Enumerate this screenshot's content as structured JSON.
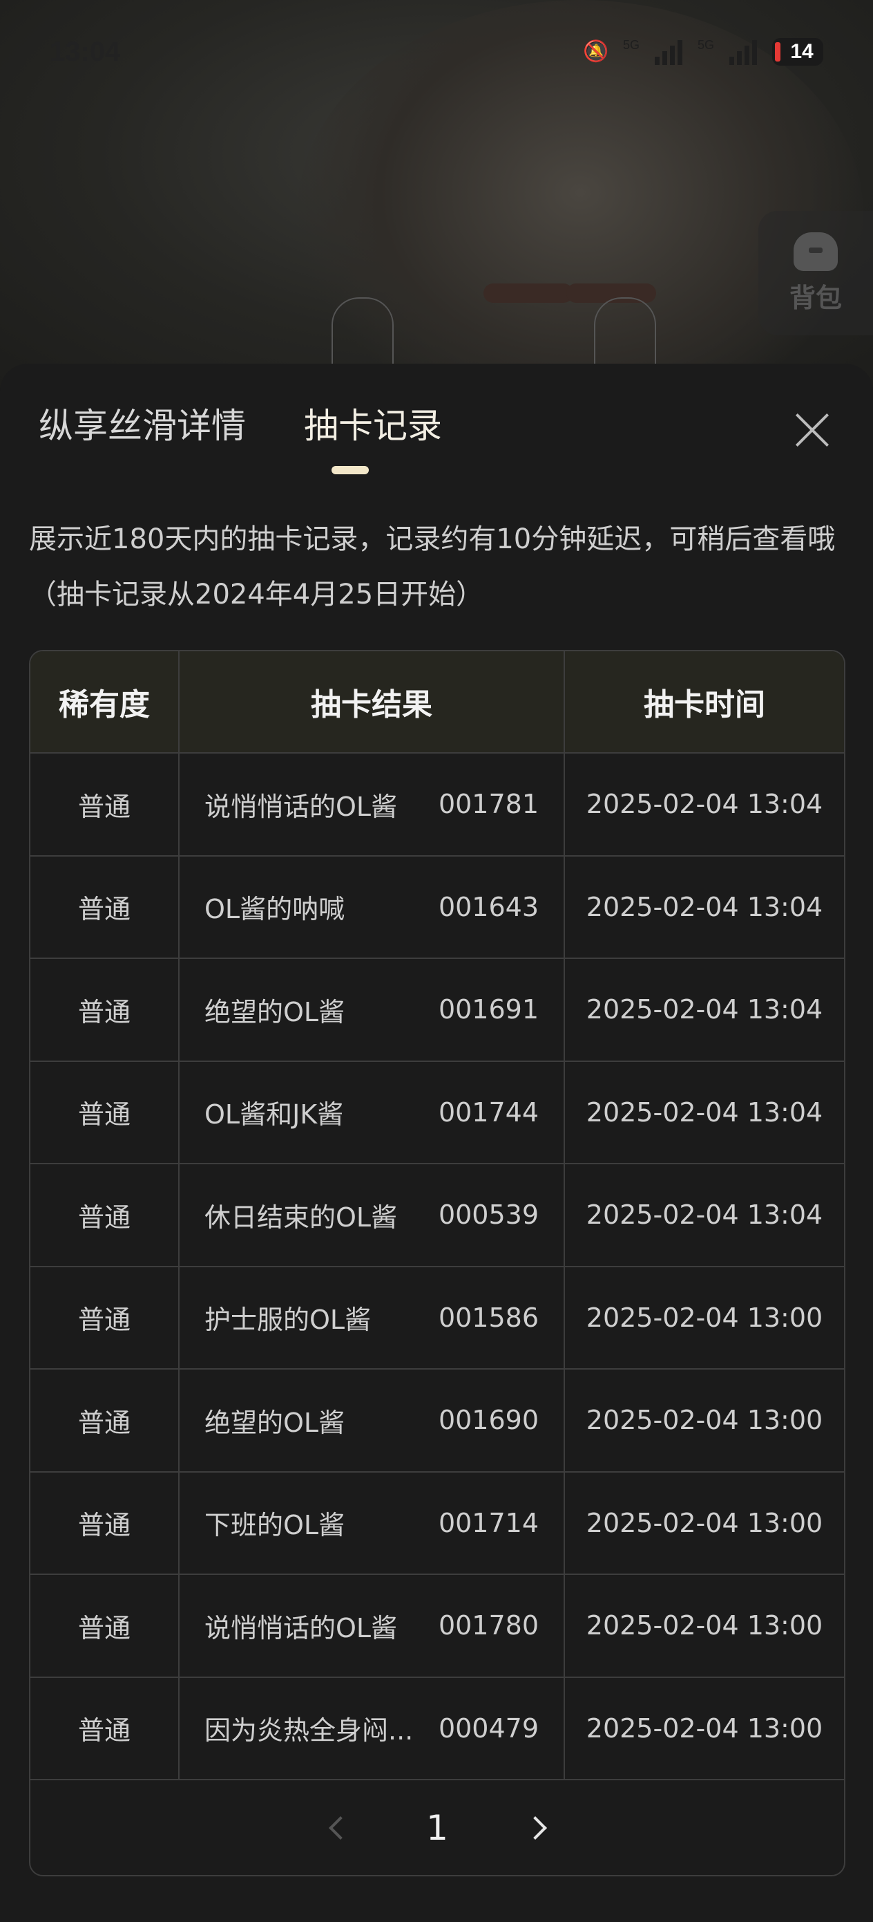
{
  "status_bar": {
    "time": "13:04",
    "network_1": "5G",
    "network_2": "5G",
    "battery": "14"
  },
  "side_button": {
    "label": "背包"
  },
  "tabs": [
    {
      "label": "纵享丝滑详情",
      "active": false
    },
    {
      "label": "抽卡记录",
      "active": true
    }
  ],
  "notice": "展示近180天内的抽卡记录，记录约有10分钟延迟，可稍后查看哦（抽卡记录从2024年4月25日开始）",
  "table": {
    "headers": [
      "稀有度",
      "抽卡结果",
      "抽卡时间"
    ],
    "rows": [
      {
        "rarity": "普通",
        "name": "说悄悄话的OL酱",
        "code": "001781",
        "time": "2025-02-04 13:04"
      },
      {
        "rarity": "普通",
        "name": "OL酱的呐喊",
        "code": "001643",
        "time": "2025-02-04 13:04"
      },
      {
        "rarity": "普通",
        "name": "绝望的OL酱",
        "code": "001691",
        "time": "2025-02-04 13:04"
      },
      {
        "rarity": "普通",
        "name": "OL酱和JK酱",
        "code": "001744",
        "time": "2025-02-04 13:04"
      },
      {
        "rarity": "普通",
        "name": "休日结束的OL酱",
        "code": "000539",
        "time": "2025-02-04 13:04"
      },
      {
        "rarity": "普通",
        "name": "护士服的OL酱",
        "code": "001586",
        "time": "2025-02-04 13:00"
      },
      {
        "rarity": "普通",
        "name": "绝望的OL酱",
        "code": "001690",
        "time": "2025-02-04 13:00"
      },
      {
        "rarity": "普通",
        "name": "下班的OL酱",
        "code": "001714",
        "time": "2025-02-04 13:00"
      },
      {
        "rarity": "普通",
        "name": "说悄悄话的OL酱",
        "code": "001780",
        "time": "2025-02-04 13:00"
      },
      {
        "rarity": "普通",
        "name": "因为炎热全身闷...",
        "code": "000479",
        "time": "2025-02-04 13:00"
      }
    ]
  },
  "pagination": {
    "current_page": "1"
  }
}
